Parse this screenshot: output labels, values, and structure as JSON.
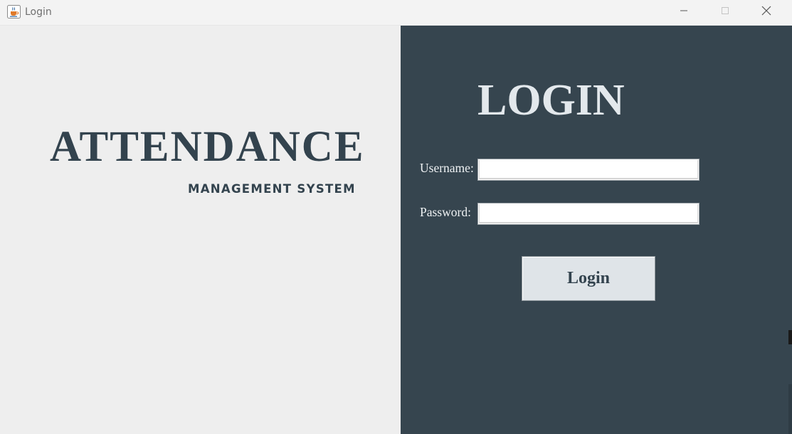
{
  "window": {
    "title": "Login",
    "icon": "java-cup-icon",
    "controls": {
      "minimize_icon": "minimize-icon",
      "maximize_icon": "maximize-icon",
      "close_icon": "close-icon"
    }
  },
  "branding": {
    "title": "ATTENDANCE",
    "subtitle": "MANAGEMENT SYSTEM"
  },
  "login_form": {
    "heading": "LOGIN",
    "username_label": "Username:",
    "username_value": "",
    "password_label": "Password:",
    "password_value": "",
    "submit_label": "Login"
  },
  "colors": {
    "left_panel_bg": "#eeeeee",
    "right_panel_bg": "#36454f",
    "brand_text": "#33434e",
    "heading_text": "#e3e8ec",
    "button_bg": "#dfe4e8"
  }
}
